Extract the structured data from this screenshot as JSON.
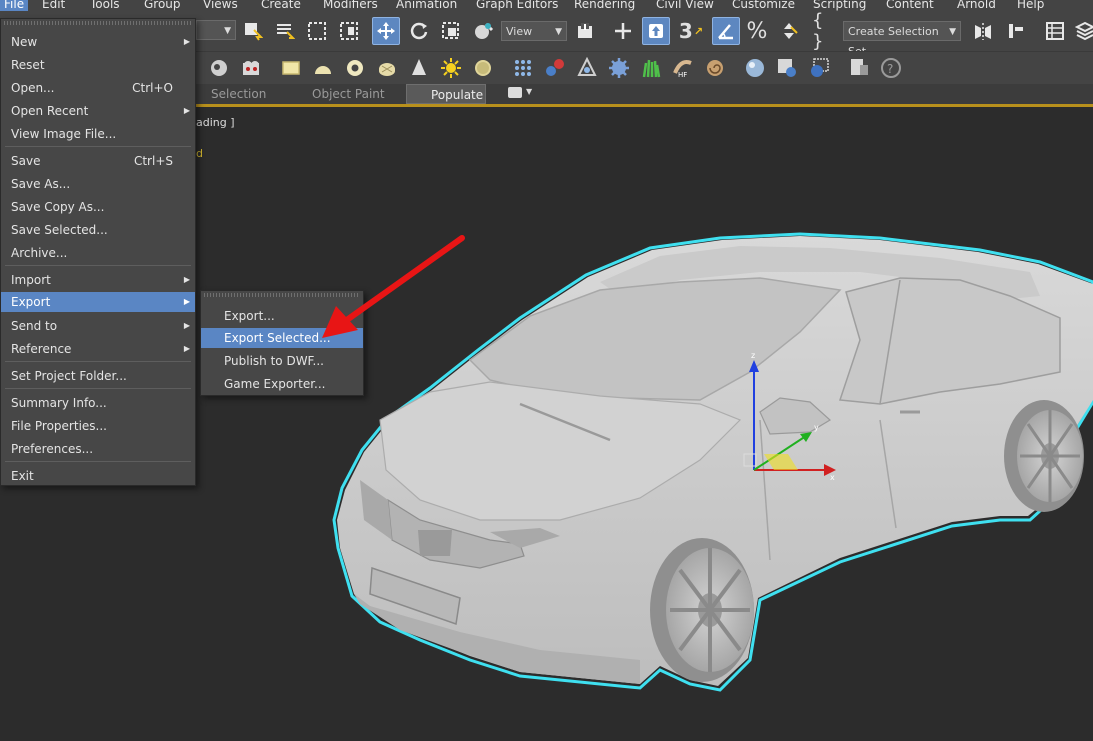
{
  "menubar": {
    "items": [
      "File",
      "Edit",
      "Tools",
      "Group",
      "Views",
      "Create",
      "Modifiers",
      "Animation",
      "Graph Editors",
      "Rendering",
      "Civil View",
      "Customize",
      "Scripting",
      "Content",
      "Arnold",
      "Help"
    ]
  },
  "toolbar": {
    "reference_coord_label": "View",
    "selection_set_label": "Create Selection Set",
    "snap_label": "3",
    "percent_snap_label": "%"
  },
  "ribbon": {
    "tabs": [
      "Selection",
      "Object Paint",
      "Populate"
    ],
    "selected": "Populate"
  },
  "viewport": {
    "label_bracket": "ading ]",
    "label_yellow": "d",
    "gizmo_axes": [
      "z",
      "y",
      "x"
    ]
  },
  "file_menu": {
    "items": [
      {
        "label": "New",
        "shortcut": "",
        "submenu": true
      },
      {
        "label": "Reset",
        "shortcut": "",
        "submenu": false
      },
      {
        "label": "Open...",
        "shortcut": "Ctrl+O",
        "submenu": false
      },
      {
        "label": "Open Recent",
        "shortcut": "",
        "submenu": true
      },
      {
        "label": "View Image File...",
        "shortcut": "",
        "submenu": false
      },
      {
        "label": "Save",
        "shortcut": "Ctrl+S",
        "submenu": false
      },
      {
        "label": "Save As...",
        "shortcut": "",
        "submenu": false
      },
      {
        "label": "Save Copy As...",
        "shortcut": "",
        "submenu": false
      },
      {
        "label": "Save Selected...",
        "shortcut": "",
        "submenu": false
      },
      {
        "label": "Archive...",
        "shortcut": "",
        "submenu": false
      },
      {
        "label": "Import",
        "shortcut": "",
        "submenu": true
      },
      {
        "label": "Export",
        "shortcut": "",
        "submenu": true
      },
      {
        "label": "Send to",
        "shortcut": "",
        "submenu": true
      },
      {
        "label": "Reference",
        "shortcut": "",
        "submenu": true
      },
      {
        "label": "Set Project Folder...",
        "shortcut": "",
        "submenu": false
      },
      {
        "label": "Summary Info...",
        "shortcut": "",
        "submenu": false
      },
      {
        "label": "File Properties...",
        "shortcut": "",
        "submenu": false
      },
      {
        "label": "Preferences...",
        "shortcut": "",
        "submenu": false
      },
      {
        "label": "Exit",
        "shortcut": "",
        "submenu": false
      }
    ],
    "highlighted": "Export"
  },
  "export_submenu": {
    "items": [
      "Export...",
      "Export Selected...",
      "Publish to DWF...",
      "Game Exporter..."
    ],
    "highlighted": "Export Selected..."
  },
  "colors": {
    "highlight": "#5a86c4",
    "selection_outline": "#3fe0f0",
    "annotation_arrow": "#e81515",
    "ribbon_accent": "#b8901c"
  }
}
